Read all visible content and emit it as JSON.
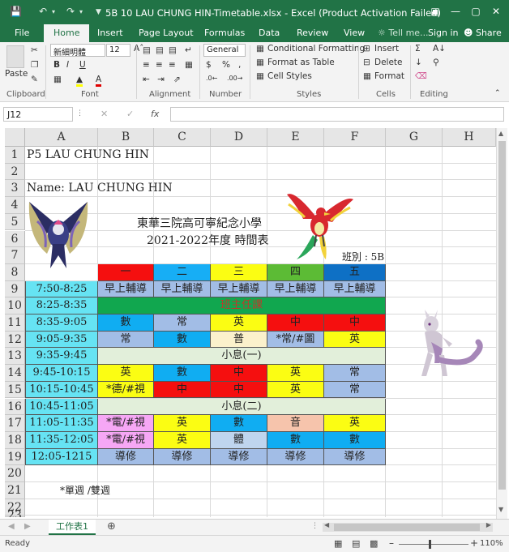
{
  "window": {
    "title": "5B 10 LAU CHUNG HIN-Timetable.xlsx - Excel (Product Activation Failed)"
  },
  "tabs": [
    "File",
    "Home",
    "Insert",
    "Page Layout",
    "Formulas",
    "Data",
    "Review",
    "View"
  ],
  "tell_me": "Tell me...",
  "sign_in": "Sign in",
  "share": "Share",
  "ribbon": {
    "paste": "Paste",
    "font_name": "新細明體",
    "font_size": "12",
    "number_format": "General",
    "conditional_formatting": "Conditional Formatting",
    "format_as_table": "Format as Table",
    "cell_styles": "Cell Styles",
    "insert": "Insert",
    "delete": "Delete",
    "format": "Format",
    "groups": {
      "clipboard": "Clipboard",
      "font": "Font",
      "alignment": "Alignment",
      "number": "Number",
      "styles": "Styles",
      "cells": "Cells",
      "editing": "Editing"
    }
  },
  "name_box": "J12",
  "formula": "",
  "columns": [
    "A",
    "B",
    "C",
    "D",
    "E",
    "F",
    "G",
    "H"
  ],
  "rows": [
    "1",
    "2",
    "3",
    "4",
    "5",
    "6",
    "7",
    "8",
    "9",
    "10",
    "11",
    "12",
    "13",
    "14",
    "15",
    "16",
    "17",
    "18",
    "19",
    "20",
    "21",
    "22",
    "23"
  ],
  "sheet": {
    "a1": "P5 LAU CHUNG HIN",
    "a3": "Name: LAU CHUNG HIN",
    "school": "東華三院高可寧紀念小學",
    "year": "2021-2022年度 時間表",
    "class_label": "班別 : 5B",
    "note": "*單週 /雙週"
  },
  "days": [
    "一",
    "二",
    "三",
    "四",
    "五"
  ],
  "timetable": [
    {
      "time": "7:50-8:25",
      "cells": [
        "早上輔導",
        "早上輔導",
        "早上輔導",
        "早上輔導",
        "早上輔導"
      ]
    },
    {
      "time": "8:25-8:35",
      "span": "班主任課"
    },
    {
      "time": "8:35-9:05",
      "cells": [
        "數",
        "常",
        "英",
        "中",
        "中"
      ]
    },
    {
      "time": "9:05-9:35",
      "cells": [
        "常",
        "數",
        "普",
        "*常/#圖",
        "英"
      ]
    },
    {
      "time": "9:35-9:45",
      "span": "小息(一)"
    },
    {
      "time": "9:45-10:15",
      "cells": [
        "英",
        "數",
        "中",
        "英",
        "常"
      ]
    },
    {
      "time": "10:15-10:45",
      "cells": [
        "*德/#視",
        "中",
        "中",
        "英",
        "常"
      ]
    },
    {
      "time": "10:45-11:05",
      "span": "小息(二)"
    },
    {
      "time": "11:05-11:35",
      "cells": [
        "*電/#視",
        "英",
        "數",
        "音",
        "英"
      ]
    },
    {
      "time": "11:35-12:05",
      "cells": [
        "*電/#視",
        "英",
        "體",
        "數",
        "數"
      ]
    },
    {
      "time": "12:05-1215",
      "cells": [
        "導修",
        "導修",
        "導修",
        "導修",
        "導修"
      ]
    }
  ],
  "colors": {
    "excel_green": "#217346",
    "time_col": "#66e3f3",
    "days": [
      "#f50f0f",
      "#17aef5",
      "#fbfd13",
      "#5cbb35",
      "#0e70c5"
    ],
    "timetable_cells": [
      [
        "#a2bde6",
        "#a2bde6",
        "#a2bde6",
        "#a2bde6",
        "#a2bde6"
      ],
      [
        "#11a74f",
        "#11a74f",
        "#11a74f",
        "#11a74f",
        "#11a74f"
      ],
      [
        "#10adf2",
        "#a2bde6",
        "#fbfd13",
        "#f50f0f",
        "#f50f0f"
      ],
      [
        "#a2bde6",
        "#10adf2",
        "#fbf1cc",
        "#a2bde6",
        "#fbfd13"
      ],
      [
        "#e2efda",
        "#e2efda",
        "#e2efda",
        "#e2efda",
        "#e2efda"
      ],
      [
        "#fbfd13",
        "#10adf2",
        "#f50f0f",
        "#fbfd13",
        "#a2bde6"
      ],
      [
        "#fbfd13",
        "#f50f0f",
        "#f50f0f",
        "#fbfd13",
        "#a2bde6"
      ],
      [
        "#e2efda",
        "#e2efda",
        "#e2efda",
        "#e2efda",
        "#e2efda"
      ],
      [
        "#f6a7f5",
        "#fbfd13",
        "#10adf2",
        "#f6c4ac",
        "#fbfd13"
      ],
      [
        "#f6a7f5",
        "#fbfd13",
        "#bfd5ee",
        "#10adf2",
        "#10adf2"
      ],
      [
        "#a2bde6",
        "#a2bde6",
        "#a2bde6",
        "#a2bde6",
        "#a2bde6"
      ]
    ],
    "span_text": "#c0392b"
  },
  "sheet_tab": "工作表1",
  "status": "Ready",
  "zoom": "110%"
}
